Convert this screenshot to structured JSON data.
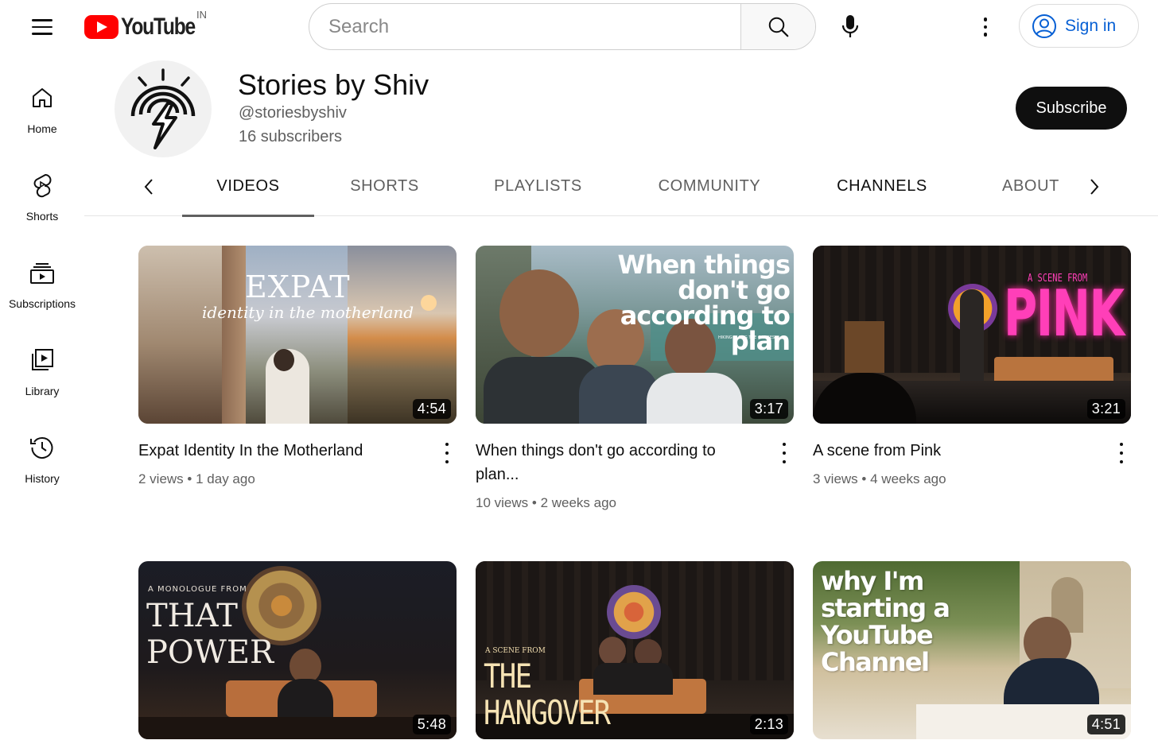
{
  "header": {
    "logo_text": "YouTube",
    "region": "IN",
    "search_placeholder": "Search",
    "sign_in_label": "Sign in"
  },
  "sidebar": {
    "items": [
      {
        "label": "Home",
        "icon": "home-icon"
      },
      {
        "label": "Shorts",
        "icon": "shorts-icon"
      },
      {
        "label": "Subscriptions",
        "icon": "subscriptions-icon"
      },
      {
        "label": "Library",
        "icon": "library-icon"
      },
      {
        "label": "History",
        "icon": "history-icon"
      }
    ]
  },
  "channel": {
    "name": "Stories by Shiv",
    "handle": "@storiesbyshiv",
    "subscribers": "16 subscribers",
    "subscribe_label": "Subscribe"
  },
  "tabs": [
    {
      "label": "VIDEOS",
      "active": true
    },
    {
      "label": "SHORTS",
      "active": false
    },
    {
      "label": "PLAYLISTS",
      "active": false
    },
    {
      "label": "COMMUNITY",
      "active": false
    },
    {
      "label": "CHANNELS",
      "active": false
    },
    {
      "label": "ABOUT",
      "active": false
    }
  ],
  "videos": [
    {
      "title": "Expat Identity In the Motherland",
      "views": "2 views",
      "age": "1 day ago",
      "duration": "4:54",
      "thumb_text": "EXPAT",
      "thumb_subtext": "identity in the motherland"
    },
    {
      "title": "When things don't go according to plan...",
      "views": "10 views",
      "age": "2 weeks ago",
      "duration": "3:17",
      "thumb_text": "When things don't go according to plan",
      "thumb_subtext": "HIKING ALONG THE GANGES"
    },
    {
      "title": "A scene from Pink",
      "views": "3 views",
      "age": "4 weeks ago",
      "duration": "3:21",
      "thumb_text": "PINK",
      "thumb_subtext": "A SCENE FROM"
    },
    {
      "title": "",
      "views": "",
      "age": "",
      "duration": "5:48",
      "thumb_text": "THAT POWER",
      "thumb_subtext": "A MONOLOGUE FROM"
    },
    {
      "title": "",
      "views": "",
      "age": "",
      "duration": "2:13",
      "thumb_text": "THE HANGOVER",
      "thumb_subtext": "A SCENE FROM"
    },
    {
      "title": "",
      "views": "",
      "age": "",
      "duration": "4:51",
      "thumb_text": "why I'm starting a YouTube Channel",
      "thumb_subtext": ""
    }
  ],
  "colors": {
    "brand_red": "#ff0000",
    "link_blue": "#065fd4",
    "text_primary": "#0f0f0f",
    "text_secondary": "#606060"
  }
}
